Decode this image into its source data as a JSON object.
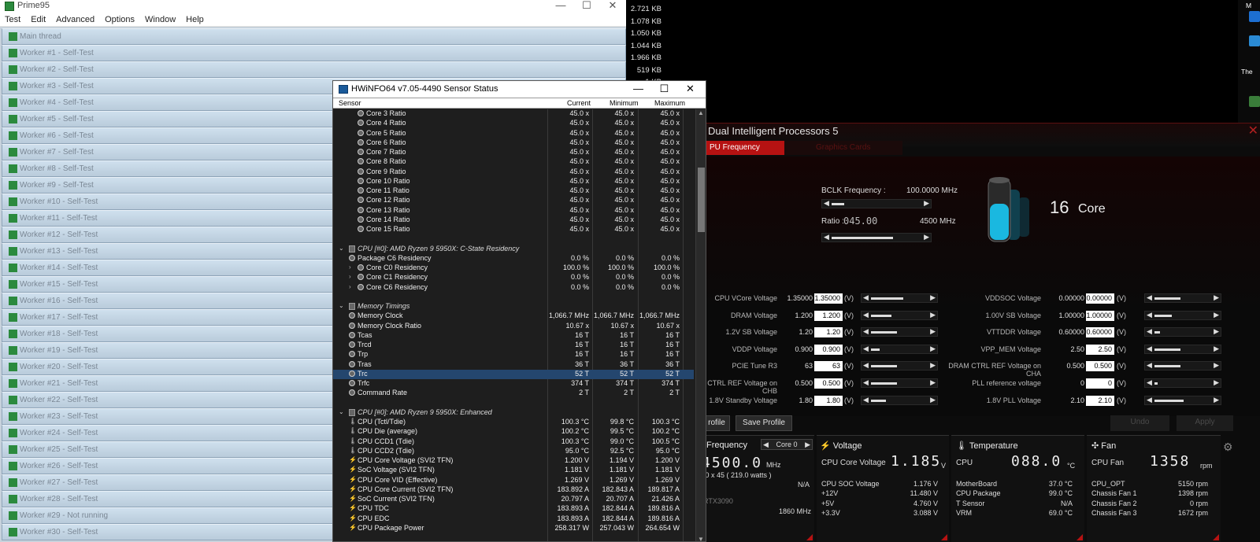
{
  "prime95": {
    "title": "Prime95",
    "menu": [
      "Test",
      "Edit",
      "Advanced",
      "Options",
      "Window",
      "Help"
    ],
    "threads": [
      "Main thread",
      "Worker #1 - Self-Test",
      "Worker #2 - Self-Test",
      "Worker #3 - Self-Test",
      "Worker #4 - Self-Test",
      "Worker #5 - Self-Test",
      "Worker #6 - Self-Test",
      "Worker #7 - Self-Test",
      "Worker #8 - Self-Test",
      "Worker #9 - Self-Test",
      "Worker #10 - Self-Test",
      "Worker #11 - Self-Test",
      "Worker #12 - Self-Test",
      "Worker #13 - Self-Test",
      "Worker #14 - Self-Test",
      "Worker #15 - Self-Test",
      "Worker #16 - Self-Test",
      "Worker #17 - Self-Test",
      "Worker #18 - Self-Test",
      "Worker #19 - Self-Test",
      "Worker #20 - Self-Test",
      "Worker #21 - Self-Test",
      "Worker #22 - Self-Test",
      "Worker #23 - Self-Test",
      "Worker #24 - Self-Test",
      "Worker #25 - Self-Test",
      "Worker #26 - Self-Test",
      "Worker #27 - Self-Test",
      "Worker #28 - Self-Test",
      "Worker #29 - Not running",
      "Worker #30 - Self-Test"
    ]
  },
  "file_sizes": [
    "2.721 KB",
    "1.078 KB",
    "1.050 KB",
    "1.044 KB",
    "1.966 KB",
    "519 KB",
    "1 KB"
  ],
  "desktop": {
    "label_m": "M",
    "label_the": "The"
  },
  "hwinfo": {
    "title": "HWiNFO64 v7.05-4490 Sensor Status",
    "columns": {
      "sensor": "Sensor",
      "current": "Current",
      "minimum": "Minimum",
      "maximum": "Maximum"
    },
    "rows": [
      {
        "kind": "item",
        "indent": 2,
        "label": "Core 3 Ratio",
        "cur": "45.0 x",
        "min": "45.0 x",
        "max": "45.0 x"
      },
      {
        "kind": "item",
        "indent": 2,
        "label": "Core 4 Ratio",
        "cur": "45.0 x",
        "min": "45.0 x",
        "max": "45.0 x"
      },
      {
        "kind": "item",
        "indent": 2,
        "label": "Core 5 Ratio",
        "cur": "45.0 x",
        "min": "45.0 x",
        "max": "45.0 x"
      },
      {
        "kind": "item",
        "indent": 2,
        "label": "Core 6 Ratio",
        "cur": "45.0 x",
        "min": "45.0 x",
        "max": "45.0 x"
      },
      {
        "kind": "item",
        "indent": 2,
        "label": "Core 7 Ratio",
        "cur": "45.0 x",
        "min": "45.0 x",
        "max": "45.0 x"
      },
      {
        "kind": "item",
        "indent": 2,
        "label": "Core 8 Ratio",
        "cur": "45.0 x",
        "min": "45.0 x",
        "max": "45.0 x"
      },
      {
        "kind": "item",
        "indent": 2,
        "label": "Core 9 Ratio",
        "cur": "45.0 x",
        "min": "45.0 x",
        "max": "45.0 x"
      },
      {
        "kind": "item",
        "indent": 2,
        "label": "Core 10 Ratio",
        "cur": "45.0 x",
        "min": "45.0 x",
        "max": "45.0 x"
      },
      {
        "kind": "item",
        "indent": 2,
        "label": "Core 11 Ratio",
        "cur": "45.0 x",
        "min": "45.0 x",
        "max": "45.0 x"
      },
      {
        "kind": "item",
        "indent": 2,
        "label": "Core 12 Ratio",
        "cur": "45.0 x",
        "min": "45.0 x",
        "max": "45.0 x"
      },
      {
        "kind": "item",
        "indent": 2,
        "label": "Core 13 Ratio",
        "cur": "45.0 x",
        "min": "45.0 x",
        "max": "45.0 x"
      },
      {
        "kind": "item",
        "indent": 2,
        "label": "Core 14 Ratio",
        "cur": "45.0 x",
        "min": "45.0 x",
        "max": "45.0 x"
      },
      {
        "kind": "item",
        "indent": 2,
        "label": "Core 15 Ratio",
        "cur": "45.0 x",
        "min": "45.0 x",
        "max": "45.0 x"
      },
      {
        "kind": "sep"
      },
      {
        "kind": "group",
        "label": "CPU [#0]: AMD Ryzen 9 5950X: C-State Residency"
      },
      {
        "kind": "item",
        "indent": 1,
        "label": "Package C6 Residency",
        "cur": "0.0 %",
        "min": "0.0 %",
        "max": "0.0 %"
      },
      {
        "kind": "item",
        "indent": 2,
        "exp": true,
        "label": "Core C0 Residency",
        "cur": "100.0 %",
        "min": "100.0 %",
        "max": "100.0 %"
      },
      {
        "kind": "item",
        "indent": 2,
        "exp": true,
        "label": "Core C1 Residency",
        "cur": "0.0 %",
        "min": "0.0 %",
        "max": "0.0 %"
      },
      {
        "kind": "item",
        "indent": 2,
        "exp": true,
        "label": "Core C6 Residency",
        "cur": "0.0 %",
        "min": "0.0 %",
        "max": "0.0 %"
      },
      {
        "kind": "sep"
      },
      {
        "kind": "group",
        "label": "Memory Timings"
      },
      {
        "kind": "item",
        "indent": 1,
        "label": "Memory Clock",
        "cur": "1,066.7 MHz",
        "min": "1,066.7 MHz",
        "max": "1,066.7 MHz"
      },
      {
        "kind": "item",
        "indent": 1,
        "label": "Memory Clock Ratio",
        "cur": "10.67 x",
        "min": "10.67 x",
        "max": "10.67 x"
      },
      {
        "kind": "item",
        "indent": 1,
        "label": "Tcas",
        "cur": "16 T",
        "min": "16 T",
        "max": "16 T"
      },
      {
        "kind": "item",
        "indent": 1,
        "label": "Trcd",
        "cur": "16 T",
        "min": "16 T",
        "max": "16 T"
      },
      {
        "kind": "item",
        "indent": 1,
        "label": "Trp",
        "cur": "16 T",
        "min": "16 T",
        "max": "16 T"
      },
      {
        "kind": "item",
        "indent": 1,
        "label": "Tras",
        "cur": "36 T",
        "min": "36 T",
        "max": "36 T"
      },
      {
        "kind": "item",
        "indent": 1,
        "label": "Trc",
        "cur": "52 T",
        "min": "52 T",
        "max": "52 T",
        "selected": true
      },
      {
        "kind": "item",
        "indent": 1,
        "label": "Trfc",
        "cur": "374 T",
        "min": "374 T",
        "max": "374 T"
      },
      {
        "kind": "item",
        "indent": 1,
        "label": "Command Rate",
        "cur": "2 T",
        "min": "2 T",
        "max": "2 T"
      },
      {
        "kind": "sep"
      },
      {
        "kind": "group",
        "label": "CPU [#0]: AMD Ryzen 9 5950X: Enhanced"
      },
      {
        "kind": "item",
        "indent": 1,
        "icon": "thermo",
        "label": "CPU (Tctl/Tdie)",
        "cur": "100.3 °C",
        "min": "99.8 °C",
        "max": "100.3 °C"
      },
      {
        "kind": "item",
        "indent": 1,
        "icon": "thermo",
        "label": "CPU Die (average)",
        "cur": "100.2 °C",
        "min": "99.5 °C",
        "max": "100.2 °C"
      },
      {
        "kind": "item",
        "indent": 1,
        "icon": "thermo",
        "label": "CPU CCD1 (Tdie)",
        "cur": "100.3 °C",
        "min": "99.0 °C",
        "max": "100.5 °C"
      },
      {
        "kind": "item",
        "indent": 1,
        "icon": "thermo",
        "label": "CPU CCD2 (Tdie)",
        "cur": "95.0 °C",
        "min": "92.5 °C",
        "max": "95.0 °C"
      },
      {
        "kind": "item",
        "indent": 1,
        "icon": "bolt",
        "label": "CPU Core Voltage (SVI2 TFN)",
        "cur": "1.200 V",
        "min": "1.194 V",
        "max": "1.200 V"
      },
      {
        "kind": "item",
        "indent": 1,
        "icon": "bolt",
        "label": "SoC Voltage (SVI2 TFN)",
        "cur": "1.181 V",
        "min": "1.181 V",
        "max": "1.181 V"
      },
      {
        "kind": "item",
        "indent": 1,
        "icon": "bolt",
        "label": "CPU Core VID (Effective)",
        "cur": "1.269 V",
        "min": "1.269 V",
        "max": "1.269 V"
      },
      {
        "kind": "item",
        "indent": 1,
        "icon": "bolt",
        "label": "CPU Core Current (SVI2 TFN)",
        "cur": "183.892 A",
        "min": "182.843 A",
        "max": "189.817 A"
      },
      {
        "kind": "item",
        "indent": 1,
        "icon": "bolt",
        "label": "SoC Current (SVI2 TFN)",
        "cur": "20.797 A",
        "min": "20.707 A",
        "max": "21.426 A"
      },
      {
        "kind": "item",
        "indent": 1,
        "icon": "bolt",
        "label": "CPU TDC",
        "cur": "183.893 A",
        "min": "182.844 A",
        "max": "189.816 A"
      },
      {
        "kind": "item",
        "indent": 1,
        "icon": "bolt",
        "label": "CPU EDC",
        "cur": "183.893 A",
        "min": "182.844 A",
        "max": "189.816 A"
      },
      {
        "kind": "item",
        "indent": 1,
        "icon": "bolt",
        "label": "CPU Package Power",
        "cur": "258.317 W",
        "min": "257.043 W",
        "max": "264.654 W"
      }
    ]
  },
  "dip": {
    "title": "Dual Intelligent Processors 5",
    "tabs": {
      "active": "PU Frequency",
      "inactive": "Graphics Cards"
    },
    "bclk_label": "BCLK Frequency :",
    "bclk_value": "100.0000 MHz",
    "ratio_label": "Ratio :",
    "ratio_digits": "045.00",
    "ratio_mhz": "4500 MHz",
    "core_count": "16",
    "core_label": "Core",
    "left_voltages": [
      {
        "label": "CPU VCore Voltage",
        "value": "1.35000",
        "box": "1.35000",
        "unit": "(V)",
        "level": 0.55
      },
      {
        "label": "DRAM Voltage",
        "value": "1.200",
        "box": "1.200",
        "unit": "(V)",
        "level": 0.35
      },
      {
        "label": "1.2V SB Voltage",
        "value": "1.20",
        "box": "1.20",
        "unit": "(V)",
        "level": 0.45
      },
      {
        "label": "VDDP Voltage",
        "value": "0.900",
        "box": "0.900",
        "unit": "(V)",
        "level": 0.15
      },
      {
        "label": "PCIE Tune R3",
        "value": "63",
        "box": "63",
        "unit": "(V)",
        "level": 0.45
      },
      {
        "label": "CTRL REF Voltage on CHB",
        "value": "0.500",
        "box": "0.500",
        "unit": "(V)",
        "level": 0.45
      },
      {
        "label": "1.8V Standby Voltage",
        "value": "1.80",
        "box": "1.80",
        "unit": "(V)",
        "level": 0.25
      }
    ],
    "right_voltages": [
      {
        "label": "VDDSOC Voltage",
        "value": "0.00000",
        "box": "0.00000",
        "unit": "(V)",
        "level": 0.45
      },
      {
        "label": "1.00V SB Voltage",
        "value": "1.00000",
        "box": "1.00000",
        "unit": "(V)",
        "level": 0.3
      },
      {
        "label": "VTTDDR Voltage",
        "value": "0.60000",
        "box": "0.60000",
        "unit": "(V)",
        "level": 0.1
      },
      {
        "label": "VPP_MEM Voltage",
        "value": "2.50",
        "box": "2.50",
        "unit": "(V)",
        "level": 0.45
      },
      {
        "label": "DRAM CTRL REF Voltage on CHA",
        "value": "0.500",
        "box": "0.500",
        "unit": "(V)",
        "level": 0.45
      },
      {
        "label": "PLL reference voltage",
        "value": "0",
        "box": "0",
        "unit": "(V)",
        "level": 0.0
      },
      {
        "label": "1.8V PLL Voltage",
        "value": "2.10",
        "box": "2.10",
        "unit": "(V)",
        "level": 0.5
      }
    ],
    "buttons": {
      "profile": "rofile",
      "save": "Save Profile",
      "undo": "Undo",
      "apply": "Apply"
    },
    "freq_panel": {
      "header": "Frequency",
      "core_select": "Core 0",
      "big": "4500.0",
      "unit": "MHz",
      "sub": ".0 x 45  ( 219.0 watts )",
      "na": "N/A",
      "gpu": "RTX3090",
      "gpu_mhz": "1860 MHz"
    },
    "volt_panel": {
      "header": "Voltage",
      "main_label": "CPU Core Voltage",
      "main_value": "1.185",
      "main_unit": "V",
      "rows": [
        {
          "l": "CPU SOC Voltage",
          "v": "1.176 V"
        },
        {
          "l": "+12V",
          "v": "11.480 V"
        },
        {
          "l": "+5V",
          "v": "4.760 V"
        },
        {
          "l": "+3.3V",
          "v": "3.088 V"
        }
      ]
    },
    "temp_panel": {
      "header": "Temperature",
      "main_label": "CPU",
      "main_value": "088.0",
      "main_unit": "°C",
      "rows": [
        {
          "l": "MotherBoard",
          "v": "37.0 °C"
        },
        {
          "l": "CPU Package",
          "v": "99.0 °C"
        },
        {
          "l": "T Sensor",
          "v": "N/A"
        },
        {
          "l": "VRM",
          "v": "69.0 °C"
        }
      ]
    },
    "fan_panel": {
      "header": "Fan",
      "main_label": "CPU Fan",
      "main_value": "1358",
      "main_unit": "rpm",
      "rows": [
        {
          "l": "CPU_OPT",
          "v": "5150 rpm"
        },
        {
          "l": "Chassis Fan 1",
          "v": "1398 rpm"
        },
        {
          "l": "Chassis Fan 2",
          "v": "0 rpm"
        },
        {
          "l": "Chassis Fan 3",
          "v": "1672 rpm"
        }
      ]
    }
  },
  "colors": {
    "dip_accent": "#b61212",
    "hwinfo_selected": "#24466e",
    "prime_row": "#c7d6e4"
  }
}
